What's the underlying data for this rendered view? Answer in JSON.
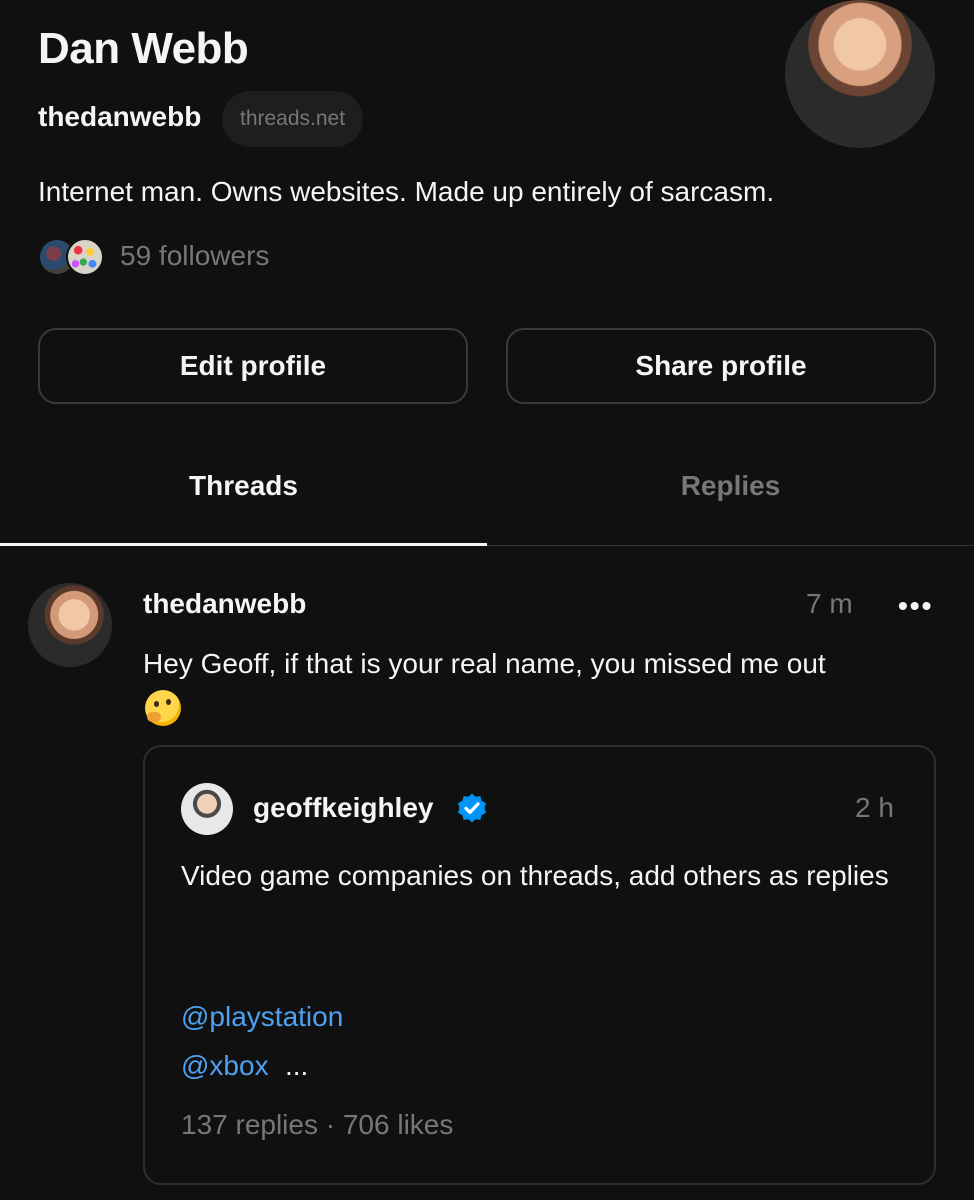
{
  "profile": {
    "display_name": "Dan Webb",
    "username": "thedanwebb",
    "domain_badge": "threads.net",
    "bio": "Internet man. Owns websites. Made up entirely of sarcasm.",
    "followers_text": "59 followers"
  },
  "actions": {
    "edit_label": "Edit profile",
    "share_label": "Share profile"
  },
  "tabs": [
    {
      "label": "Threads",
      "active": true
    },
    {
      "label": "Replies",
      "active": false
    }
  ],
  "post": {
    "username": "thedanwebb",
    "time": "7 m",
    "more": "•••",
    "text": "Hey Geoff, if that is your real name, you missed me out",
    "emoji_icon": "thinking-face-emoji",
    "quoted": {
      "username": "geoffkeighley",
      "verified": true,
      "time": "2 h",
      "text": "Video game companies on threads, add others as replies",
      "mentions": [
        "@playstation",
        "@xbox"
      ],
      "ellipsis": "...",
      "stats": "137 replies · 706 likes"
    }
  },
  "colors": {
    "background": "#101010",
    "muted": "#777777",
    "link": "#4ea1f0",
    "verified": "#0095f6"
  }
}
